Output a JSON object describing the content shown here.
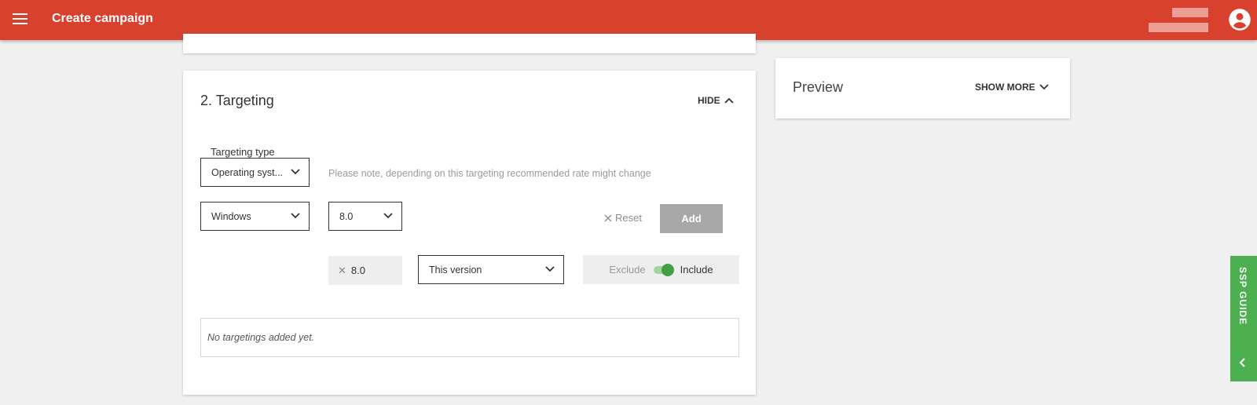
{
  "header": {
    "title": "Create campaign",
    "menu_icon": "menu-icon",
    "avatar_icon": "account-circle-icon",
    "brand_color": "#d9412f"
  },
  "targeting": {
    "title": "2. Targeting",
    "hide_label": "HIDE",
    "type_label": "Targeting type",
    "type_value": "Operating syst...",
    "note": "Please note, depending on this targeting recommended rate might change",
    "os_value": "Windows",
    "version_value": "8.0",
    "reset_label": "Reset",
    "add_label": "Add",
    "chip_value": "8.0",
    "version_mode": "This version",
    "exclude_label": "Exclude",
    "include_label": "Include",
    "include_selected": true,
    "empty_message": "No targetings added yet."
  },
  "preview": {
    "title": "Preview",
    "show_more_label": "SHOW MORE"
  },
  "guide": {
    "label": "SSP GUIDE",
    "accent_color": "#4caf50"
  }
}
